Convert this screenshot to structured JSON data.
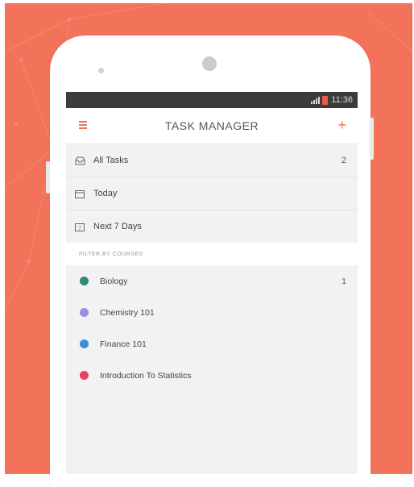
{
  "status_bar": {
    "time": "11:36"
  },
  "app_bar": {
    "title": "TASK MANAGER"
  },
  "nav_items": [
    {
      "label": "All Tasks",
      "count": "2",
      "icon": "inbox-icon"
    },
    {
      "label": "Today",
      "count": "",
      "icon": "calendar-icon"
    },
    {
      "label": "Next 7 Days",
      "count": "",
      "icon": "calendar-week-icon"
    }
  ],
  "section_header": "FILTER BY COURSES",
  "courses": [
    {
      "label": "Biology",
      "count": "1",
      "color": "#2e8b78"
    },
    {
      "label": "Chemistry 101",
      "count": "",
      "color": "#9b8fe0"
    },
    {
      "label": "Finance 101",
      "count": "",
      "color": "#3a8fd6"
    },
    {
      "label": "Introduction To Statistics",
      "count": "",
      "color": "#e8416a"
    }
  ],
  "colors": {
    "accent": "#f3735a",
    "background": "#f3735a"
  }
}
